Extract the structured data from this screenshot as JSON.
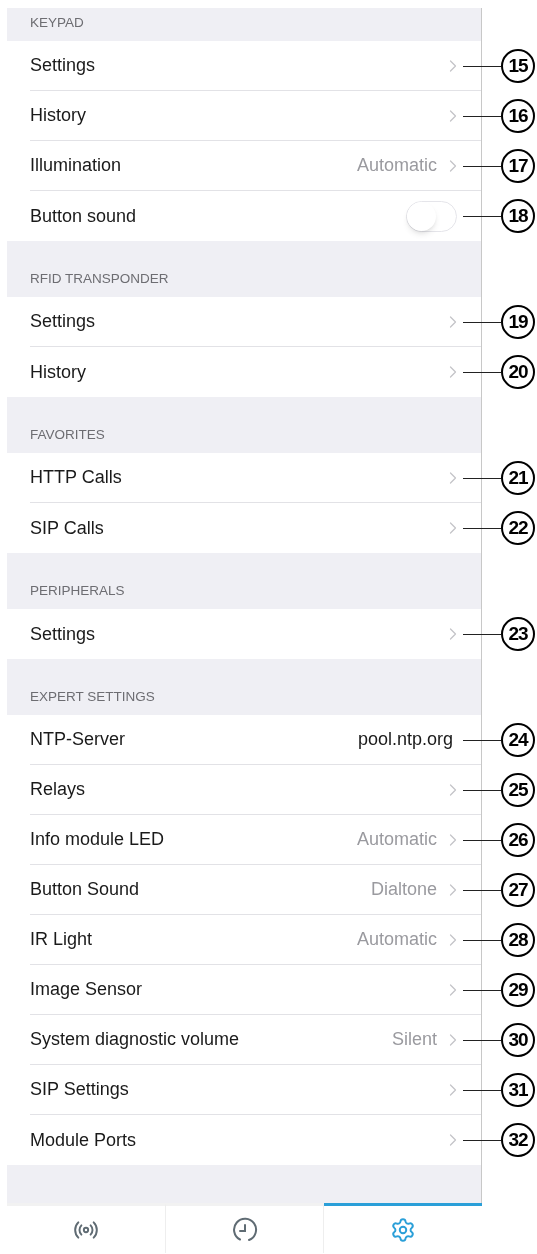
{
  "sections": [
    {
      "header": "KEYPAD",
      "rows": [
        {
          "kind": "chevron",
          "label": "Settings",
          "callout": "15"
        },
        {
          "kind": "chevron",
          "label": "History",
          "callout": "16"
        },
        {
          "kind": "chevron",
          "label": "Illumination",
          "value": "Automatic",
          "callout": "17"
        },
        {
          "kind": "toggle",
          "label": "Button sound",
          "on": false,
          "callout": "18"
        }
      ]
    },
    {
      "header": "RFID TRANSPONDER",
      "rows": [
        {
          "kind": "chevron",
          "label": "Settings",
          "callout": "19"
        },
        {
          "kind": "chevron",
          "label": "History",
          "callout": "20"
        }
      ]
    },
    {
      "header": "FAVORITES",
      "rows": [
        {
          "kind": "chevron",
          "label": "HTTP Calls",
          "callout": "21"
        },
        {
          "kind": "chevron",
          "label": "SIP Calls",
          "callout": "22"
        }
      ]
    },
    {
      "header": "PERIPHERALS",
      "rows": [
        {
          "kind": "chevron",
          "label": "Settings",
          "callout": "23"
        }
      ]
    },
    {
      "header": "EXPERT SETTINGS",
      "rows": [
        {
          "kind": "value",
          "label": "NTP-Server",
          "value": "pool.ntp.org",
          "callout": "24"
        },
        {
          "kind": "chevron",
          "label": "Relays",
          "callout": "25"
        },
        {
          "kind": "chevron",
          "label": "Info module LED",
          "value": "Automatic",
          "callout": "26"
        },
        {
          "kind": "chevron",
          "label": "Button Sound",
          "value": "Dialtone",
          "callout": "27"
        },
        {
          "kind": "chevron",
          "label": "IR Light",
          "value": "Automatic",
          "callout": "28"
        },
        {
          "kind": "chevron",
          "label": "Image Sensor",
          "callout": "29"
        },
        {
          "kind": "chevron",
          "label": "System diagnostic volume",
          "value": "Silent",
          "callout": "30"
        },
        {
          "kind": "chevron",
          "label": "SIP Settings",
          "callout": "31"
        },
        {
          "kind": "chevron",
          "label": "Module Ports",
          "callout": "32"
        }
      ]
    }
  ],
  "tabs": [
    {
      "kind": "signal",
      "selected": false
    },
    {
      "kind": "clock",
      "selected": false
    },
    {
      "kind": "gear",
      "selected": true
    }
  ]
}
